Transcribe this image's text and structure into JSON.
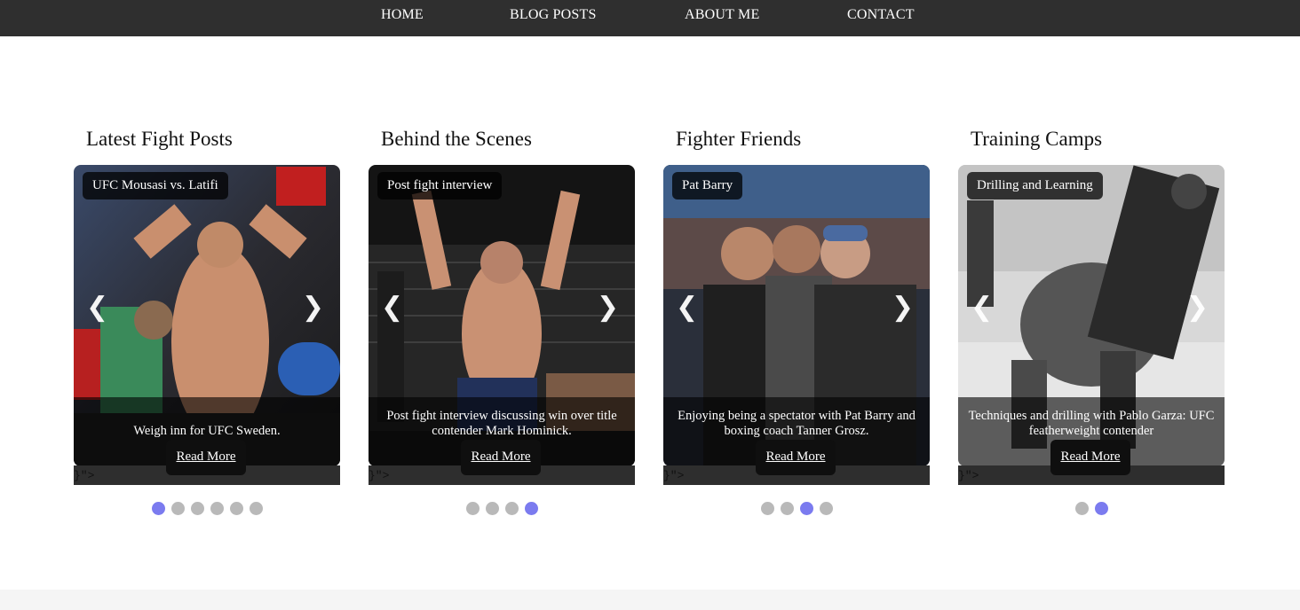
{
  "nav": {
    "items": [
      "HOME",
      "BLOG POSTS",
      "ABOUT ME",
      "CONTACT"
    ]
  },
  "columns": [
    {
      "title": "Latest Fight Posts",
      "tag": "UFC Mousasi vs. Latifi",
      "caption": "Weigh inn for UFC Sweden.",
      "read_more": "Read More",
      "stray": "}\">",
      "dots": 6,
      "active_dot": 0
    },
    {
      "title": "Behind the Scenes",
      "tag": "Post fight interview",
      "caption": "Post fight interview discussing win over title contender Mark Hominick.",
      "read_more": "Read More",
      "stray": "}\">",
      "dots": 4,
      "active_dot": 3
    },
    {
      "title": "Fighter Friends",
      "tag": "Pat Barry",
      "caption": "Enjoying being a spectator with Pat Barry and boxing coach Tanner Grosz.",
      "read_more": "Read More",
      "stray": "}\">",
      "dots": 4,
      "active_dot": 2
    },
    {
      "title": "Training Camps",
      "tag": "Drilling and Learning",
      "caption": "Techniques and drilling with Pablo Garza: UFC featherweight contender",
      "read_more": "Read More",
      "stray": "}\">",
      "dots": 2,
      "active_dot": 1
    }
  ],
  "icons": {
    "prev": "chevron-left-icon",
    "next": "chevron-right-icon"
  },
  "colors": {
    "nav_bg": "#2f2f2f",
    "dot_active": "#7b7bef",
    "dot_inactive": "#b9b9b9"
  }
}
